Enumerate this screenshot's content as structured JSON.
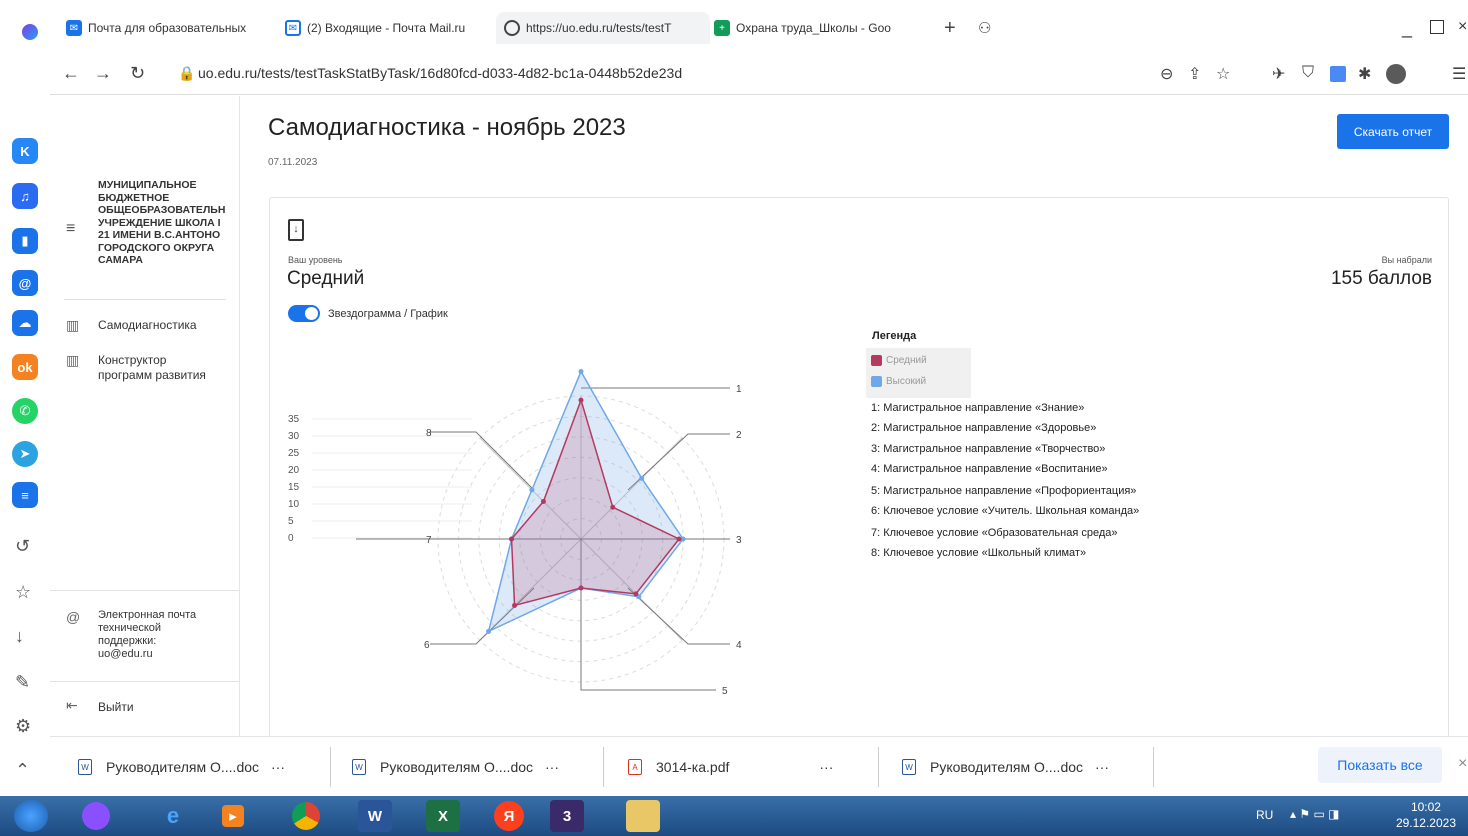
{
  "browser": {
    "tabs": [
      {
        "label": "Почта для образовательных",
        "icon": "mail-icon",
        "color": "#1a73e8"
      },
      {
        "label": "(2) Входящие - Почта Mail.ru",
        "icon": "mailru-icon",
        "color": "#1a73e8"
      },
      {
        "label": "https://uo.edu.ru/tests/testT",
        "icon": "site-icon",
        "color": "#555555"
      },
      {
        "label": "Охрана труда_Школы - Goo",
        "icon": "sheets-icon",
        "color": "#0f9d58"
      }
    ],
    "url": "uo.edu.ru/tests/testTaskStatByTask/16d80fcd-d033-4d82-bc1a-0448b52de23d"
  },
  "nav": {
    "org_name": [
      "МУНИЦИПАЛЬНОЕ",
      "БЮДЖЕТНОЕ",
      "ОБЩЕОБРАЗОВАТЕЛЬН",
      "УЧРЕЖДЕНИЕ ШКОЛА I",
      "21 ИМЕНИ В.С.АНТОНО",
      "ГОРОДСКОГО ОКРУГА",
      "САМАРА"
    ],
    "items": [
      {
        "label": "Самодиагностика"
      },
      {
        "label": "Конструктор программ развития"
      }
    ],
    "support": "Электронная почта технической поддержки: uo@edu.ru",
    "logout": "Выйти"
  },
  "main": {
    "title": "Самодиагностика - ноябрь 2023",
    "date": "07.11.2023",
    "download_label": "Скачать отчет",
    "level_label": "Ваш уровень",
    "level": "Средний",
    "score_label": "Вы набрали",
    "score": "155 баллов",
    "toggle_label": "Звездограмма / График",
    "legend_title": "Легенда"
  },
  "chart_data": {
    "type": "radar",
    "axes": [
      "1",
      "2",
      "3",
      "4",
      "5",
      "6",
      "7",
      "8"
    ],
    "axis_descriptions": [
      "1: Магистральное направление «Знание»",
      "2: Магистральное направление «Здоровье»",
      "3: Магистральное направление «Творчество»",
      "4: Магистральное направление «Воспитание»",
      "5: Магистральное направление «Профориентация»",
      "6: Ключевое условие «Учитель. Школьная команда»",
      "7: Ключевое условие «Образовательная среда»",
      "8: Ключевое условие «Школьный климат»"
    ],
    "ticks": [
      "35",
      "30",
      "25",
      "20",
      "15",
      "10",
      "5",
      "0"
    ],
    "rmax": 35,
    "series": [
      {
        "name": "Средний",
        "color": "#b5395f",
        "values": [
          34,
          11,
          24,
          19,
          12,
          23,
          17,
          13
        ]
      },
      {
        "name": "Высокий",
        "color": "#6fa8e8",
        "values": [
          41,
          21,
          25,
          20,
          12,
          32,
          17,
          17
        ]
      }
    ]
  },
  "downloads": [
    {
      "name": "Руководителям О....doc",
      "more": "···"
    },
    {
      "name": "Руководителям О....doc",
      "more": "···"
    },
    {
      "name": "3014-ка.pdf",
      "more": "···"
    },
    {
      "name": "Руководителям О....doc",
      "more": "···"
    }
  ],
  "show_all": "Показать все",
  "taskbar": {
    "lang": "RU",
    "time": "10:02",
    "date": "29.12.2023"
  }
}
